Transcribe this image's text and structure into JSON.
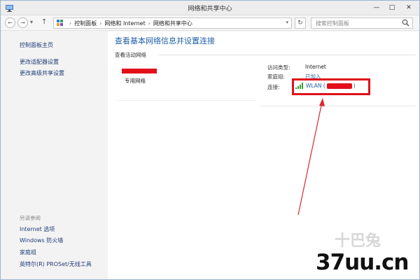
{
  "window": {
    "title": "网络和共享中心",
    "controls": {
      "minimize": "—",
      "maximize": "□",
      "close": "✕"
    }
  },
  "nav": {
    "back": "←",
    "forward": "→",
    "recent": "▾",
    "up": "↑",
    "refresh": "↻"
  },
  "breadcrumbs": [
    "控制面板",
    "网络和 Internet",
    "网络和共享中心"
  ],
  "search": {
    "placeholder": "搜索控制面板"
  },
  "sidebar": {
    "items": [
      {
        "label": "控制面板主页"
      },
      {
        "label": "更改适配器设置"
      },
      {
        "label": "更改高级共享设置"
      }
    ],
    "see_also": {
      "heading": "另请参阅",
      "links": [
        {
          "label": "Internet 选项"
        },
        {
          "label": "Windows 防火墙"
        },
        {
          "label": "家庭组"
        },
        {
          "label": "英特尔(R) PROSet/无线工具"
        }
      ]
    }
  },
  "main": {
    "title": "查看基本网络信息并设置连接",
    "active_networks_heading": "查看活动网络",
    "network": {
      "type": "专用网络"
    },
    "info": {
      "access_type_label": "访问类型:",
      "access_type_value": "Internet",
      "homegroup_label": "家庭组:",
      "homegroup_value": "已加入",
      "connection_label": "连接:",
      "connection_prefix": "WLAN (",
      "connection_suffix": ")"
    }
  },
  "watermark": {
    "text": "37uu.cn",
    "secondary": "十巴兔"
  },
  "colors": {
    "link": "#1e5fa8",
    "highlight": "#e0101a",
    "arrow": "#d8292f",
    "window_border": "#9ab6cf"
  },
  "icons": {
    "app": "network-icon",
    "control_panel": "control-panel-icon",
    "search": "search-icon",
    "wifi": "wifi-signal-icon"
  }
}
